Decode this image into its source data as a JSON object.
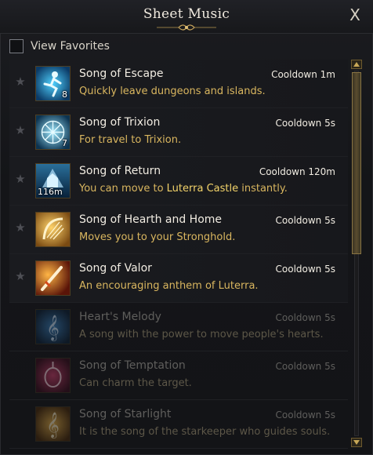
{
  "window": {
    "title": "Sheet Music",
    "close_label": "X"
  },
  "filter": {
    "view_favorites_label": "View Favorites",
    "view_favorites_checked": false
  },
  "songs": [
    {
      "name": "Song of Escape",
      "description": "Quickly leave dungeons and islands.",
      "cooldown": "Cooldown 1m",
      "count": "8",
      "icon": "running-figure-icon",
      "available": true
    },
    {
      "name": "Song of Trixion",
      "description": "For travel to Trixion.",
      "cooldown": "Cooldown 5s",
      "count": "7",
      "icon": "snowflake-sigil-icon",
      "available": true
    },
    {
      "name": "Song of Return",
      "description_before": "You can move to ",
      "description_highlight": "Luterra Castle",
      "description_after": " instantly.",
      "cooldown": "Cooldown 120m",
      "count": "116m",
      "icon": "castle-return-icon",
      "available": true
    },
    {
      "name": "Song of Hearth and Home",
      "description": "Moves you to your Stronghold.",
      "cooldown": "Cooldown 5s",
      "icon": "golden-harp-icon",
      "available": true
    },
    {
      "name": "Song of Valor",
      "description": "An encouraging anthem of Luterra.",
      "cooldown": "Cooldown 5s",
      "icon": "flaming-sword-icon",
      "available": true
    },
    {
      "name": "Heart's Melody",
      "description": "A song with the power to move people's hearts.",
      "cooldown": "Cooldown 5s",
      "icon": "treble-clef-blue-icon",
      "available": false
    },
    {
      "name": "Song of Temptation",
      "description": "Can charm the target.",
      "cooldown": "Cooldown 5s",
      "icon": "charm-lute-icon",
      "available": false
    },
    {
      "name": "Song of Starlight",
      "description": "It is the song of the starkeeper who guides souls.",
      "cooldown": "Cooldown 5s",
      "icon": "treble-clef-gold-icon",
      "available": false
    }
  ],
  "colors": {
    "accent_gold": "#d9b65f",
    "highlight_gold": "#f2d36a",
    "text_primary": "#f1ece2",
    "text_disabled": "#5f5e5c"
  }
}
